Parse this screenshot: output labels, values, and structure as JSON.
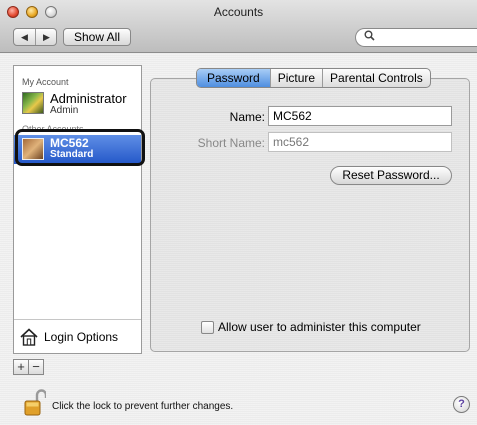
{
  "window": {
    "title": "Accounts"
  },
  "toolbar": {
    "back_icon": "◀",
    "forward_icon": "▶",
    "show_all_label": "Show All",
    "search_icon": "magnifier-icon",
    "search_placeholder": ""
  },
  "sidebar": {
    "my_account_header": "My Account",
    "other_accounts_header": "Other Accounts",
    "accounts": [
      {
        "name": "Administrator",
        "role": "Admin",
        "selected": false
      },
      {
        "name": "MC562",
        "role": "Standard",
        "selected": true
      }
    ],
    "login_options_label": "Login Options",
    "add_label": "+",
    "remove_label": "−"
  },
  "tabs": [
    {
      "label": "Password",
      "active": true
    },
    {
      "label": "Picture",
      "active": false
    },
    {
      "label": "Parental Controls",
      "active": false
    }
  ],
  "form": {
    "name_label": "Name:",
    "name_value": "MC562",
    "short_name_label": "Short Name:",
    "short_name_value": "mc562",
    "reset_password_label": "Reset Password...",
    "allow_admin_label": "Allow user to administer this computer",
    "allow_admin_checked": false
  },
  "footer": {
    "lock_text": "Click the lock to prevent further changes.",
    "help_label": "?"
  },
  "colors": {
    "selection": "#2f63d6",
    "active_tab": "#6ea6ea",
    "highlight_outline": "#111111"
  }
}
